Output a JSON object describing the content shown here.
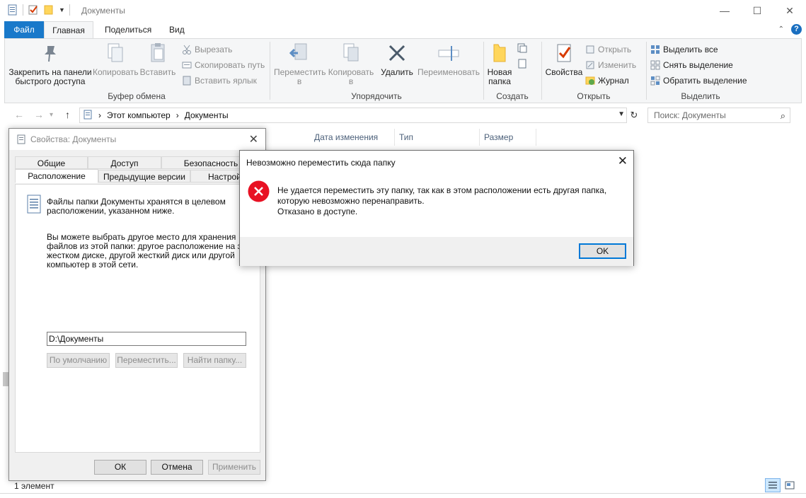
{
  "window": {
    "title": "Документы",
    "controls": {
      "minimize": "—",
      "maximize": "☐",
      "close": "✕"
    }
  },
  "ribbon_tabs": [
    "Файл",
    "Главная",
    "Поделиться",
    "Вид"
  ],
  "ribbon": {
    "clipboard": {
      "label": "Буфер обмена",
      "pin": "Закрепить на панели быстрого доступа",
      "copy": "Копировать",
      "paste": "Вставить",
      "cut": "Вырезать",
      "copy_path": "Скопировать путь",
      "paste_shortcut": "Вставить ярлык"
    },
    "organize": {
      "label": "Упорядочить",
      "move_to": "Переместить в",
      "copy_to": "Копировать в",
      "delete": "Удалить",
      "rename": "Переименовать"
    },
    "create": {
      "label": "Создать",
      "new_folder": "Новая папка"
    },
    "open": {
      "label": "Открыть",
      "properties": "Свойства",
      "open": "Открыть",
      "edit": "Изменить",
      "history": "Журнал"
    },
    "select": {
      "label": "Выделить",
      "select_all": "Выделить все",
      "select_none": "Снять выделение",
      "invert": "Обратить выделение"
    }
  },
  "address": {
    "crumbs": [
      "Этот компьютер",
      "Документы"
    ],
    "search_placeholder": "Поиск: Документы"
  },
  "columns": [
    "Дата изменения",
    "Тип",
    "Размер"
  ],
  "status": {
    "items": "1 элемент"
  },
  "properties_dialog": {
    "title": "Свойства: Документы",
    "tabs_row1": [
      "Общие",
      "Доступ",
      "Безопасность"
    ],
    "tabs_row2": [
      "Расположение",
      "Предыдущие версии",
      "Настройка"
    ],
    "intro": [
      "Файлы папки Документы хранятся в целевом",
      "расположении, указанном ниже."
    ],
    "hint": [
      "Вы можете выбрать другое место для хранения",
      "файлов из этой папки: другое расположение на этом",
      "жестком диске, другой жесткий диск или другой",
      "компьютер в этой сети."
    ],
    "path": "D:\\Документы",
    "btn_default": "По умолчанию",
    "btn_move": "Переместить...",
    "btn_find": "Найти папку...",
    "ok": "ОК",
    "cancel": "Отмена",
    "apply": "Применить"
  },
  "error_dialog": {
    "title": "Невозможно переместить сюда папку",
    "message": [
      "Не удается переместить эту папку, так как в этом расположении есть другая папка,",
      "которую невозможно перенаправить.",
      "Отказано в доступе."
    ],
    "ok": "OK",
    "icon": "error-icon",
    "icon_color": "#e81123"
  },
  "colors": {
    "file_tab": "#1979ca",
    "ribbon_bg": "#f5f6f7",
    "dialog_bg": "#f0f0f0",
    "focus": "#0078d7"
  }
}
